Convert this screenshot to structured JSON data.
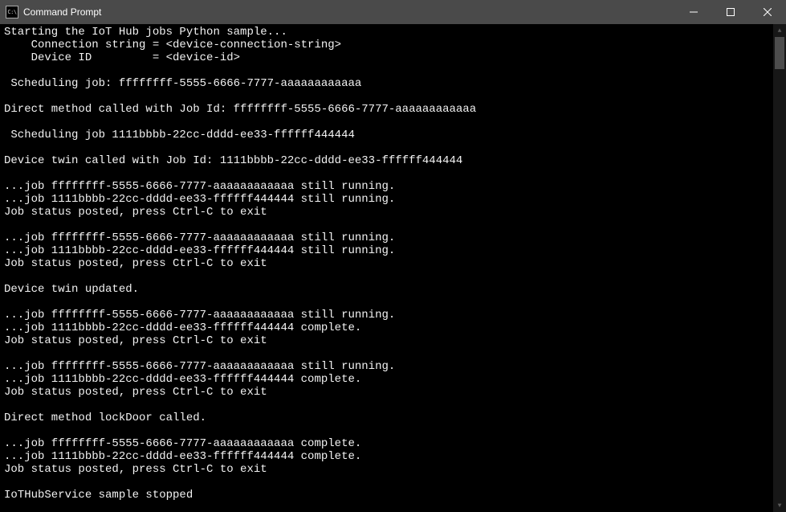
{
  "window": {
    "title": "Command Prompt",
    "icon_label": "C:\\"
  },
  "terminal": {
    "lines": [
      "Starting the IoT Hub jobs Python sample...",
      "    Connection string = <device-connection-string>",
      "    Device ID         = <device-id>",
      "",
      " Scheduling job: ffffffff-5555-6666-7777-aaaaaaaaaaaa",
      "",
      "Direct method called with Job Id: ffffffff-5555-6666-7777-aaaaaaaaaaaa",
      "",
      " Scheduling job 1111bbbb-22cc-dddd-ee33-ffffff444444",
      "",
      "Device twin called with Job Id: 1111bbbb-22cc-dddd-ee33-ffffff444444",
      "",
      "...job ffffffff-5555-6666-7777-aaaaaaaaaaaa still running.",
      "...job 1111bbbb-22cc-dddd-ee33-ffffff444444 still running.",
      "Job status posted, press Ctrl-C to exit",
      "",
      "...job ffffffff-5555-6666-7777-aaaaaaaaaaaa still running.",
      "...job 1111bbbb-22cc-dddd-ee33-ffffff444444 still running.",
      "Job status posted, press Ctrl-C to exit",
      "",
      "Device twin updated.",
      "",
      "...job ffffffff-5555-6666-7777-aaaaaaaaaaaa still running.",
      "...job 1111bbbb-22cc-dddd-ee33-ffffff444444 complete.",
      "Job status posted, press Ctrl-C to exit",
      "",
      "...job ffffffff-5555-6666-7777-aaaaaaaaaaaa still running.",
      "...job 1111bbbb-22cc-dddd-ee33-ffffff444444 complete.",
      "Job status posted, press Ctrl-C to exit",
      "",
      "Direct method lockDoor called.",
      "",
      "...job ffffffff-5555-6666-7777-aaaaaaaaaaaa complete.",
      "...job 1111bbbb-22cc-dddd-ee33-ffffff444444 complete.",
      "Job status posted, press Ctrl-C to exit",
      "",
      "IoTHubService sample stopped"
    ]
  }
}
